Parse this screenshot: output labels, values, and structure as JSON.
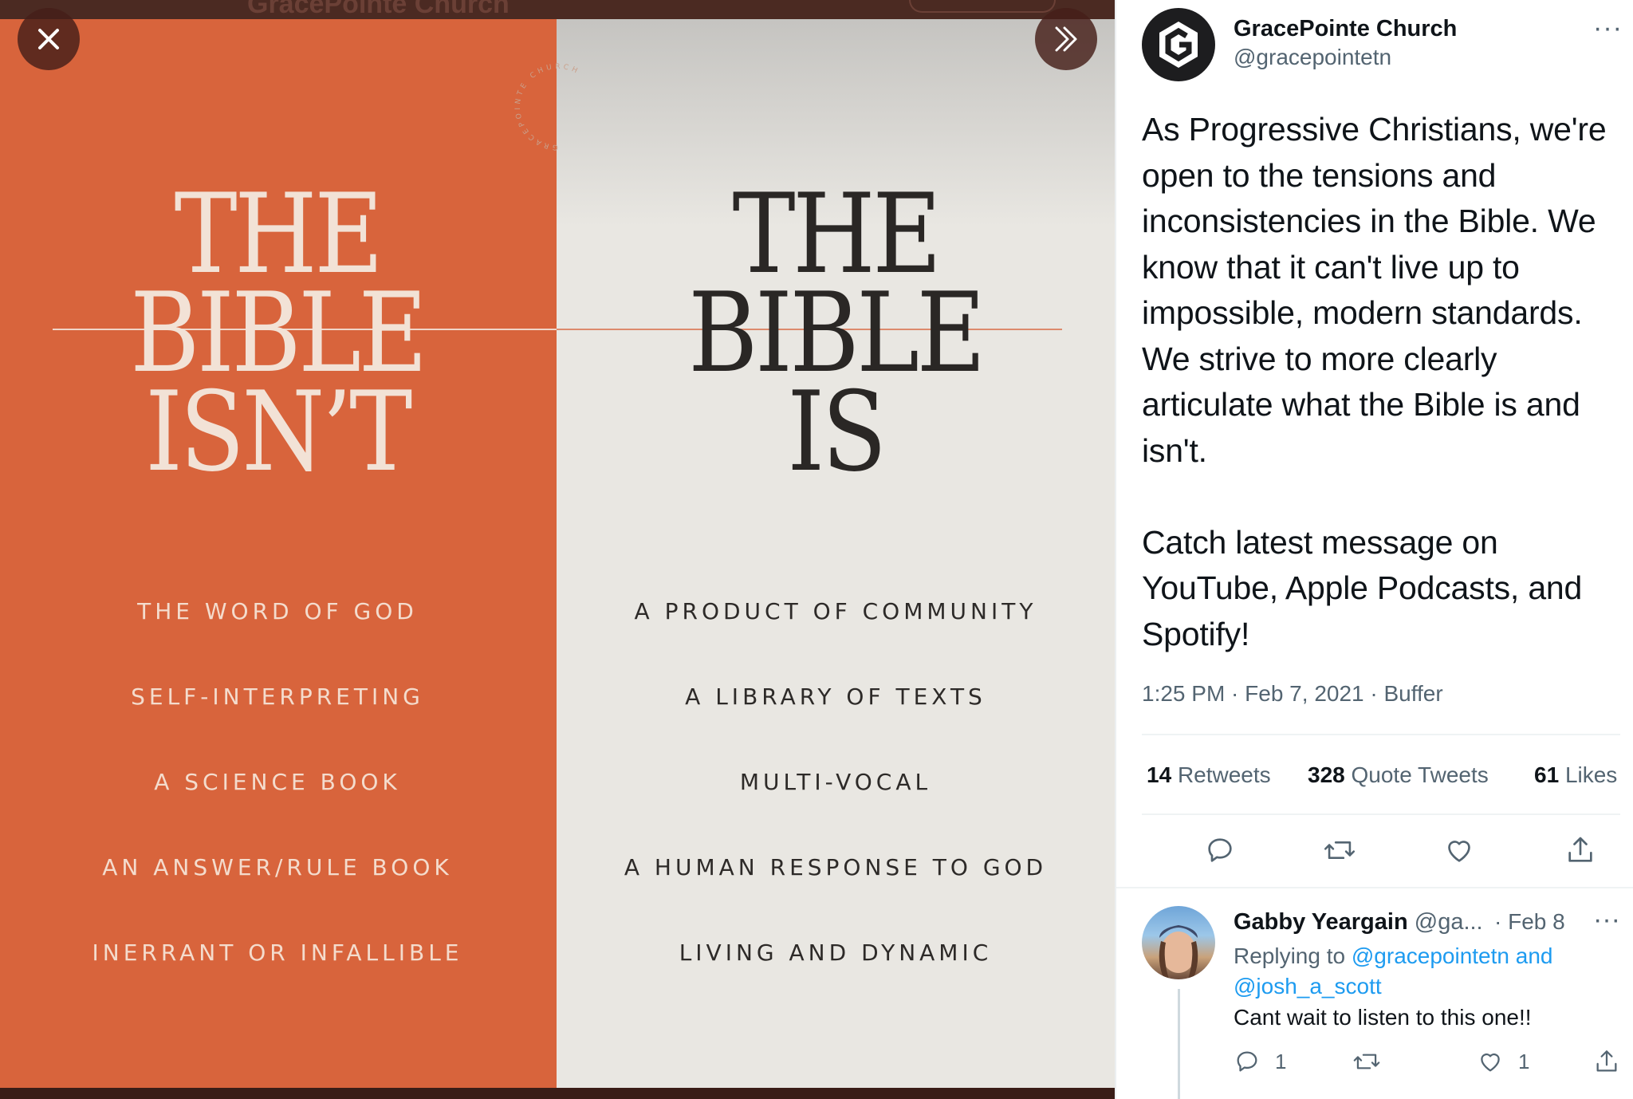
{
  "viewer": {
    "background_title": "GracePointe Church",
    "seal_text": "GRACEPOINTE CHURCH",
    "left": {
      "heading": "THE\nBIBLE\nISN’T",
      "items": [
        "THE WORD OF GOD",
        "SELF-INTERPRETING",
        "A SCIENCE BOOK",
        "AN ANSWER/RULE BOOK",
        "INERRANT OR INFALLIBLE"
      ],
      "bg_color": "#d8643c"
    },
    "right": {
      "heading": "THE\nBIBLE\nIS",
      "items": [
        "A PRODUCT OF COMMUNITY",
        "A LIBRARY OF TEXTS",
        "MULTI-VOCAL",
        "A HUMAN RESPONSE TO GOD",
        "LIVING AND DYNAMIC"
      ],
      "bg_color": "#e9e7e2"
    },
    "close_icon": "close-icon",
    "next_icon": "double-chevron-right-icon"
  },
  "tweet": {
    "author": {
      "name": "GracePointe Church",
      "handle": "@gracepointetn"
    },
    "text": "As Progressive Christians, we're open to the tensions and inconsistencies in the Bible. We know that it can't live up to impossible, modern standards. We strive to more clearly articulate what the Bible is and isn't.\n\nCatch latest message on YouTube, Apple Podcasts, and Spotify!",
    "meta": "1:25 PM · Feb 7, 2021 · Buffer",
    "stats": {
      "retweets_count": "14",
      "retweets_label": "Retweets",
      "quotes_count": "328",
      "quotes_label": "Quote Tweets",
      "likes_count": "61",
      "likes_label": "Likes"
    },
    "more_icon": "···"
  },
  "reply": {
    "name": "Gabby Yeargain",
    "handle": "@ga...",
    "date": "· Feb 8",
    "replying_prefix": "Replying to",
    "mention1": "@gracepointetn",
    "and": "and",
    "mention2": "@josh_a_scott",
    "text": "Cant wait to listen to this one!!",
    "reply_count": "1",
    "like_count": "1"
  },
  "colors": {
    "accent": "#1d9bf0",
    "secondary_text": "#536471",
    "orange": "#d8643c"
  }
}
